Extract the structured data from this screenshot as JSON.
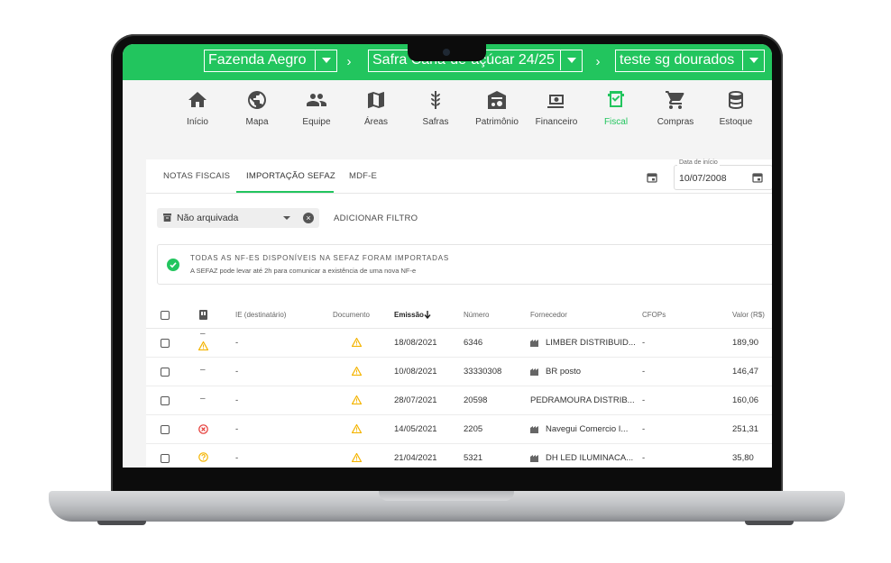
{
  "header": {
    "farm": "Fazenda Aegro",
    "season": "Safra Cana-de-açúcar 24/25",
    "workspace": "teste sg dourados",
    "separator": "›"
  },
  "modules": [
    {
      "label": "Início",
      "icon": "home-icon"
    },
    {
      "label": "Mapa",
      "icon": "globe-icon"
    },
    {
      "label": "Equipe",
      "icon": "team-icon"
    },
    {
      "label": "Áreas",
      "icon": "map-icon"
    },
    {
      "label": "Safras",
      "icon": "wheat-icon"
    },
    {
      "label": "Patrimônio",
      "icon": "tractor-shed-icon"
    },
    {
      "label": "Financeiro",
      "icon": "money-icon"
    },
    {
      "label": "Fiscal",
      "icon": "fiscal-icon",
      "active": true
    },
    {
      "label": "Compras",
      "icon": "cart-icon"
    },
    {
      "label": "Estoque",
      "icon": "database-icon"
    }
  ],
  "tabs": {
    "notas": "NOTAS FISCAIS",
    "importacao": "IMPORTAÇÃO SEFAZ",
    "mdfe": "MDF-E"
  },
  "date_filter": {
    "label": "Data de início",
    "value": "10/07/2008"
  },
  "filter": {
    "chip": "Não arquivada",
    "add": "ADICIONAR FILTRO"
  },
  "notice": {
    "title": "TODAS AS NF-ES DISPONÍVEIS NA SEFAZ FORAM IMPORTADAS",
    "subtitle": "A SEFAZ pode levar até 2h para comunicar a existência de uma nova NF-e"
  },
  "table": {
    "headers": {
      "ie": "IE (destinatário)",
      "documento": "Documento",
      "emissao": "Emissão",
      "numero": "Número",
      "fornecedor": "Fornecedor",
      "cfops": "CFOPs",
      "valor": "Valor (R$)"
    },
    "rows": [
      {
        "status": "warning",
        "ie": "-",
        "emissao": "18/08/2021",
        "numero": "6346",
        "fornecedor": "LIMBER DISTRIBUID...",
        "cfops": "-",
        "valor": "189,90",
        "building": true
      },
      {
        "status": "dash",
        "ie": "-",
        "emissao": "10/08/2021",
        "numero": "33330308",
        "fornecedor": "BR posto",
        "cfops": "-",
        "valor": "146,47",
        "building": true
      },
      {
        "status": "dash",
        "ie": "-",
        "emissao": "28/07/2021",
        "numero": "20598",
        "fornecedor": "PEDRAMOURA DISTRIB...",
        "cfops": "-",
        "valor": "160,06",
        "building": false
      },
      {
        "status": "error",
        "ie": "-",
        "emissao": "14/05/2021",
        "numero": "2205",
        "fornecedor": "Navegui Comercio I...",
        "cfops": "-",
        "valor": "251,31",
        "building": true
      },
      {
        "status": "question",
        "ie": "-",
        "emissao": "21/04/2021",
        "numero": "5321",
        "fornecedor": "DH LED ILUMINACA...",
        "cfops": "-",
        "valor": "35,80",
        "building": true
      }
    ]
  },
  "colors": {
    "brand_green": "#22c55e",
    "warning": "#f4b400",
    "error": "#e53935"
  }
}
